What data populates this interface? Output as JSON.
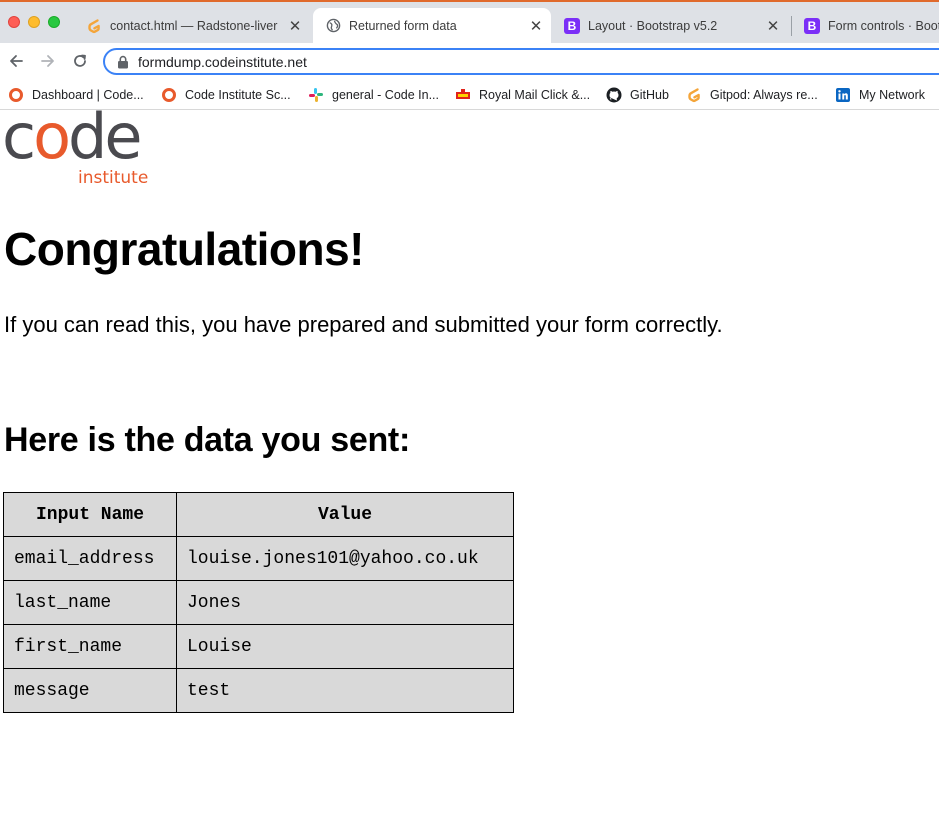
{
  "browser": {
    "tabs": [
      {
        "label": "contact.html — Radstone-liver",
        "icon": "gitpod-icon",
        "active": false
      },
      {
        "label": "Returned form data",
        "icon": "globe-icon",
        "active": true
      },
      {
        "label": "Layout · Bootstrap v5.2",
        "icon": "bootstrap-icon",
        "active": false
      },
      {
        "label": "Form controls · Boot",
        "icon": "bootstrap-icon",
        "active": false
      }
    ],
    "url": "formdump.codeinstitute.net",
    "bookmarks": [
      {
        "label": "Dashboard | Code...",
        "icon": "codeinstitute-icon"
      },
      {
        "label": "Code Institute Sc...",
        "icon": "codeinstitute-icon"
      },
      {
        "label": "general - Code In...",
        "icon": "slack-icon"
      },
      {
        "label": "Royal Mail Click &...",
        "icon": "royal-mail-icon"
      },
      {
        "label": "GitHub",
        "icon": "github-icon"
      },
      {
        "label": "Gitpod: Always re...",
        "icon": "gitpod-icon"
      },
      {
        "label": "My Network",
        "icon": "linkedin-icon"
      }
    ]
  },
  "page": {
    "logo": {
      "word": "code",
      "sub": "institute"
    },
    "heading": "Congratulations!",
    "message": "If you can read this, you have prepared and submitted your form correctly.",
    "subheading": "Here is the data you sent:",
    "table": {
      "headers": [
        "Input Name",
        "Value"
      ],
      "rows": [
        [
          "email_address",
          "louise.jones101@yahoo.co.uk"
        ],
        [
          "last_name",
          "Jones"
        ],
        [
          "first_name",
          "Louise"
        ],
        [
          "message",
          "test"
        ]
      ]
    }
  },
  "colors": {
    "brand_orange": "#e85a2c",
    "brand_grey": "#4a4a4f",
    "table_bg": "#d9d9d9",
    "focus_blue": "#3b82f6"
  }
}
